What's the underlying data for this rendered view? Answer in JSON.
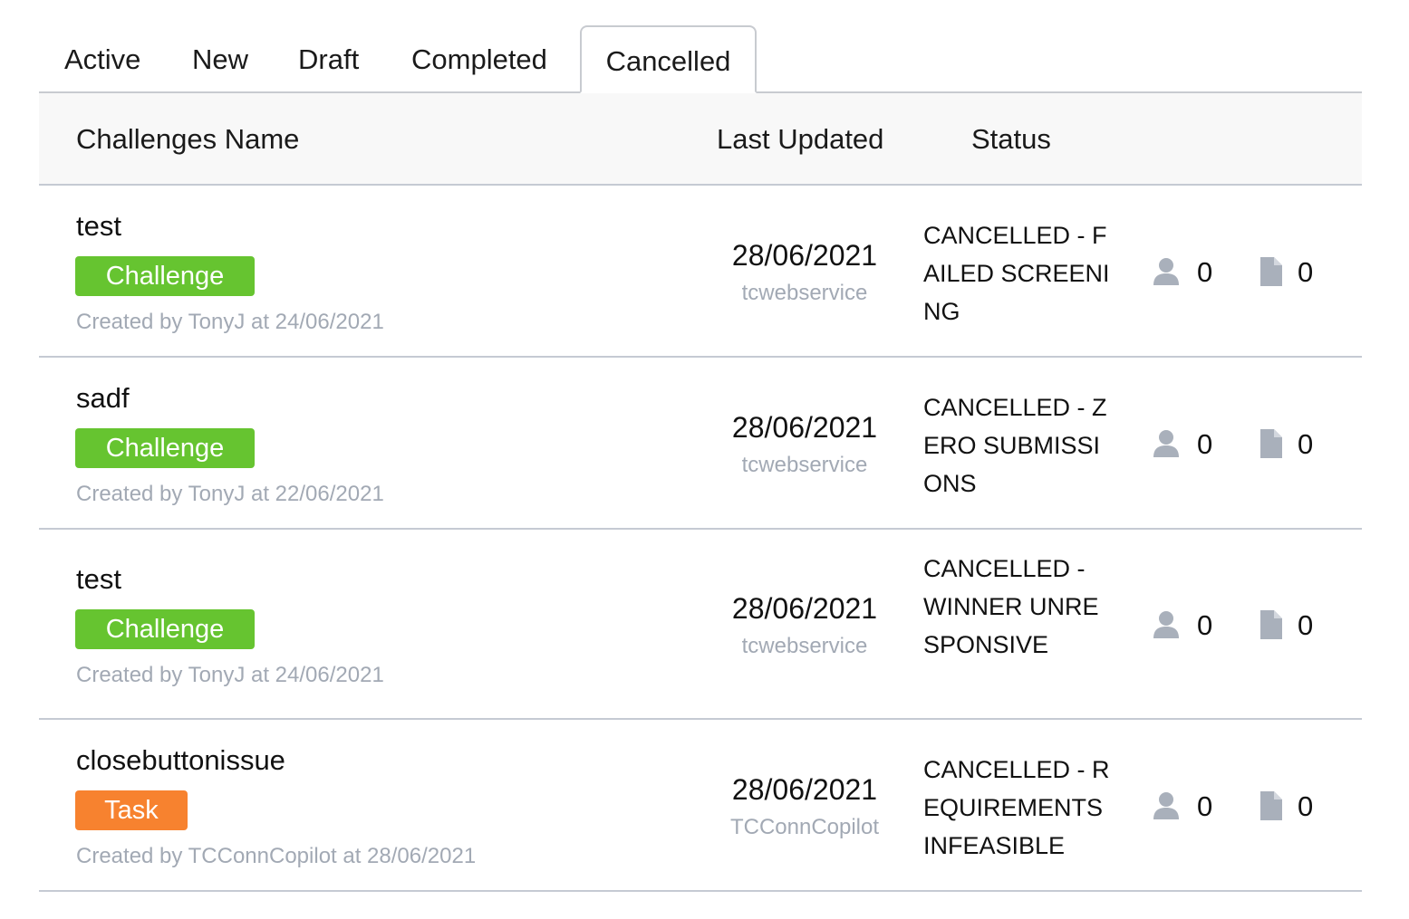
{
  "tabs": [
    {
      "label": "Active"
    },
    {
      "label": "New"
    },
    {
      "label": "Draft"
    },
    {
      "label": "Completed"
    },
    {
      "label": "Cancelled",
      "active": true
    }
  ],
  "table": {
    "headers": {
      "name": "Challenges Name",
      "last_updated": "Last Updated",
      "status": "Status"
    },
    "rows": [
      {
        "name": "test",
        "type": "Challenge",
        "created": "Created by TonyJ at 24/06/2021",
        "date": "28/06/2021",
        "updated_by": "tcwebservice",
        "status": "CANCELLED - FAILED SCREENING",
        "registrants": "0",
        "submissions": "0"
      },
      {
        "name": "sadf",
        "type": "Challenge",
        "created": "Created by TonyJ at 22/06/2021",
        "date": "28/06/2021",
        "updated_by": "tcwebservice",
        "status": "CANCELLED - ZERO SUBMISSIONS",
        "registrants": "0",
        "submissions": "0"
      },
      {
        "name": "test",
        "type": "Challenge",
        "created": "Created by TonyJ at 24/06/2021",
        "date": "28/06/2021",
        "updated_by": "tcwebservice",
        "status": "CANCELLED - WINNER UNRESPONSIVE",
        "registrants": "0",
        "submissions": "0"
      },
      {
        "name": "closebuttonissue",
        "type": "Task",
        "created": "Created by TCConnCopilot at 28/06/2021",
        "date": "28/06/2021",
        "updated_by": "TCConnCopilot",
        "status": "CANCELLED - REQUIREMENTS INFEASIBLE",
        "registrants": "0",
        "submissions": "0"
      }
    ]
  },
  "icons": {
    "registrants": "user-icon",
    "submissions": "document-icon"
  },
  "colors": {
    "challenge_badge": "#66c430",
    "task_badge": "#f7822f",
    "muted_text": "#a2a9b4",
    "icon": "#a9b0bb"
  }
}
